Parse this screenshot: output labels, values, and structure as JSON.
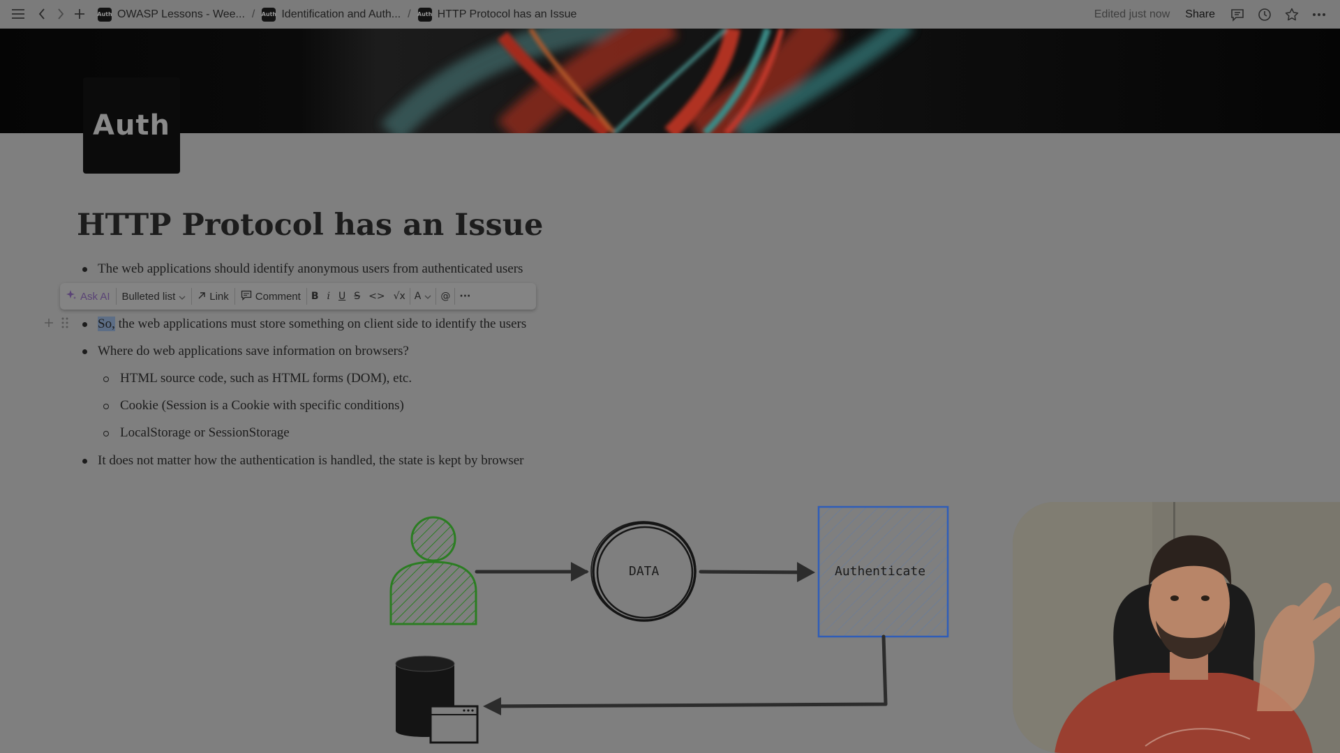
{
  "topbar": {
    "breadcrumbs": [
      {
        "label": "OWASP Lessons - Wee..."
      },
      {
        "label": "Identification and Auth..."
      },
      {
        "label": "HTTP Protocol has an Issue"
      }
    ],
    "crumb_icon_text": "Auth",
    "separator": "/",
    "edited": "Edited just now",
    "share": "Share"
  },
  "page": {
    "icon_text": "Auth",
    "title": "HTTP Protocol has an Issue"
  },
  "toolbar": {
    "ask_ai": "Ask AI",
    "block_type": "Bulleted list",
    "link": "Link",
    "comment": "Comment",
    "bold": "B",
    "italic": "i",
    "underline": "U",
    "strike": "S",
    "code": "<>",
    "math": "√x",
    "color": "A",
    "mention": "@",
    "more": "···"
  },
  "bullets": [
    {
      "text": "The web applications should identify anonymous users from authenticated users"
    },
    {
      "highlight": "So,",
      "text": " the web applications must store something on client side to identify the users"
    },
    {
      "text": "Where do web applications save information on browsers?"
    },
    {
      "text": "HTML source code, such as HTML forms (DOM), etc."
    },
    {
      "text": "Cookie (Session is a Cookie with specific conditions)"
    },
    {
      "text": "LocalStorage or SessionStorage"
    },
    {
      "text": "It does not matter how the authentication is handled, the state is kept by browser"
    }
  ],
  "diagram": {
    "data_label": "DATA",
    "auth_label": "Authenticate"
  },
  "colors": {
    "user_green": "#2b7d22",
    "auth_blue": "#2f5db8"
  }
}
